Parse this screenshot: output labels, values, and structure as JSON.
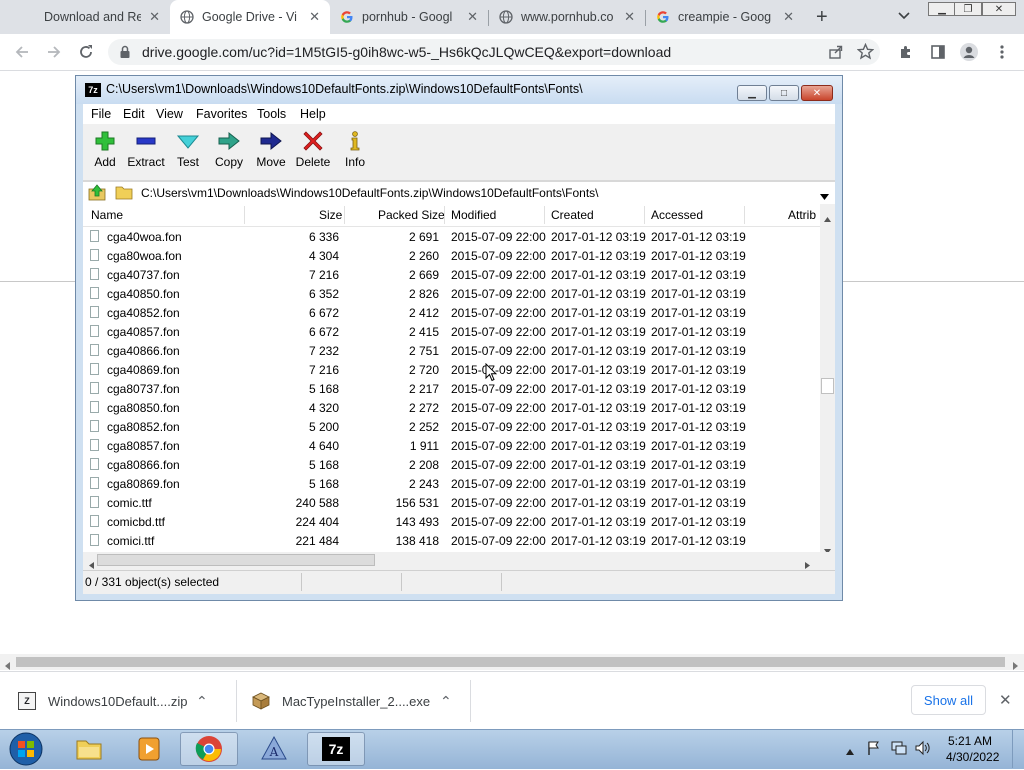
{
  "browser": {
    "tabs": [
      {
        "title": "Download and Re",
        "active": false
      },
      {
        "title": "Google Drive - Vi",
        "active": true
      },
      {
        "title": "pornhub - Googl",
        "active": false
      },
      {
        "title": "www.pornhub.co",
        "active": false
      },
      {
        "title": "creampie - Goog",
        "active": false
      }
    ],
    "new_tab_label": "+",
    "tab_close_label": "✕",
    "url": "drive.google.com/uc?id=1M5tGI5-g0ih8wc-w5-_Hs6kQcJLQwCEQ&export=download"
  },
  "zip": {
    "title": "C:\\Users\\vm1\\Downloads\\Windows10DefaultFonts.zip\\Windows10DefaultFonts\\Fonts\\",
    "menu": [
      "File",
      "Edit",
      "View",
      "Favorites",
      "Tools",
      "Help"
    ],
    "toolbar": [
      "Add",
      "Extract",
      "Test",
      "Copy",
      "Move",
      "Delete",
      "Info"
    ],
    "address": "C:\\Users\\vm1\\Downloads\\Windows10DefaultFonts.zip\\Windows10DefaultFonts\\Fonts\\",
    "columns": [
      "Name",
      "Size",
      "Packed Size",
      "Modified",
      "Created",
      "Accessed",
      "Attrib"
    ],
    "rows": [
      [
        "cga40woa.fon",
        "6 336",
        "2 691",
        "2015-07-09 22:00",
        "2017-01-12 03:19",
        "2017-01-12 03:19"
      ],
      [
        "cga80woa.fon",
        "4 304",
        "2 260",
        "2015-07-09 22:00",
        "2017-01-12 03:19",
        "2017-01-12 03:19"
      ],
      [
        "cga40737.fon",
        "7 216",
        "2 669",
        "2015-07-09 22:00",
        "2017-01-12 03:19",
        "2017-01-12 03:19"
      ],
      [
        "cga40850.fon",
        "6 352",
        "2 826",
        "2015-07-09 22:00",
        "2017-01-12 03:19",
        "2017-01-12 03:19"
      ],
      [
        "cga40852.fon",
        "6 672",
        "2 412",
        "2015-07-09 22:00",
        "2017-01-12 03:19",
        "2017-01-12 03:19"
      ],
      [
        "cga40857.fon",
        "6 672",
        "2 415",
        "2015-07-09 22:00",
        "2017-01-12 03:19",
        "2017-01-12 03:19"
      ],
      [
        "cga40866.fon",
        "7 232",
        "2 751",
        "2015-07-09 22:00",
        "2017-01-12 03:19",
        "2017-01-12 03:19"
      ],
      [
        "cga40869.fon",
        "7 216",
        "2 720",
        "2015-07-09 22:00",
        "2017-01-12 03:19",
        "2017-01-12 03:19"
      ],
      [
        "cga80737.fon",
        "5 168",
        "2 217",
        "2015-07-09 22:00",
        "2017-01-12 03:19",
        "2017-01-12 03:19"
      ],
      [
        "cga80850.fon",
        "4 320",
        "2 272",
        "2015-07-09 22:00",
        "2017-01-12 03:19",
        "2017-01-12 03:19"
      ],
      [
        "cga80852.fon",
        "5 200",
        "2 252",
        "2015-07-09 22:00",
        "2017-01-12 03:19",
        "2017-01-12 03:19"
      ],
      [
        "cga80857.fon",
        "4 640",
        "1 911",
        "2015-07-09 22:00",
        "2017-01-12 03:19",
        "2017-01-12 03:19"
      ],
      [
        "cga80866.fon",
        "5 168",
        "2 208",
        "2015-07-09 22:00",
        "2017-01-12 03:19",
        "2017-01-12 03:19"
      ],
      [
        "cga80869.fon",
        "5 168",
        "2 243",
        "2015-07-09 22:00",
        "2017-01-12 03:19",
        "2017-01-12 03:19"
      ],
      [
        "comic.ttf",
        "240 588",
        "156 531",
        "2015-07-09 22:00",
        "2017-01-12 03:19",
        "2017-01-12 03:19"
      ],
      [
        "comicbd.ttf",
        "224 404",
        "143 493",
        "2015-07-09 22:00",
        "2017-01-12 03:19",
        "2017-01-12 03:19"
      ],
      [
        "comici.ttf",
        "221 484",
        "138 418",
        "2015-07-09 22:00",
        "2017-01-12 03:19",
        "2017-01-12 03:19"
      ]
    ],
    "status": "0 / 331 object(s) selected"
  },
  "downloads": {
    "items": [
      "Windows10Default....zip",
      "MacTypeInstaller_2....exe"
    ],
    "chevron_label": "⌃",
    "show_all": "Show all",
    "close_label": "✕"
  },
  "taskbar": {
    "time": "5:21 AM",
    "date": "4/30/2022",
    "zip_app_label": "7z"
  }
}
